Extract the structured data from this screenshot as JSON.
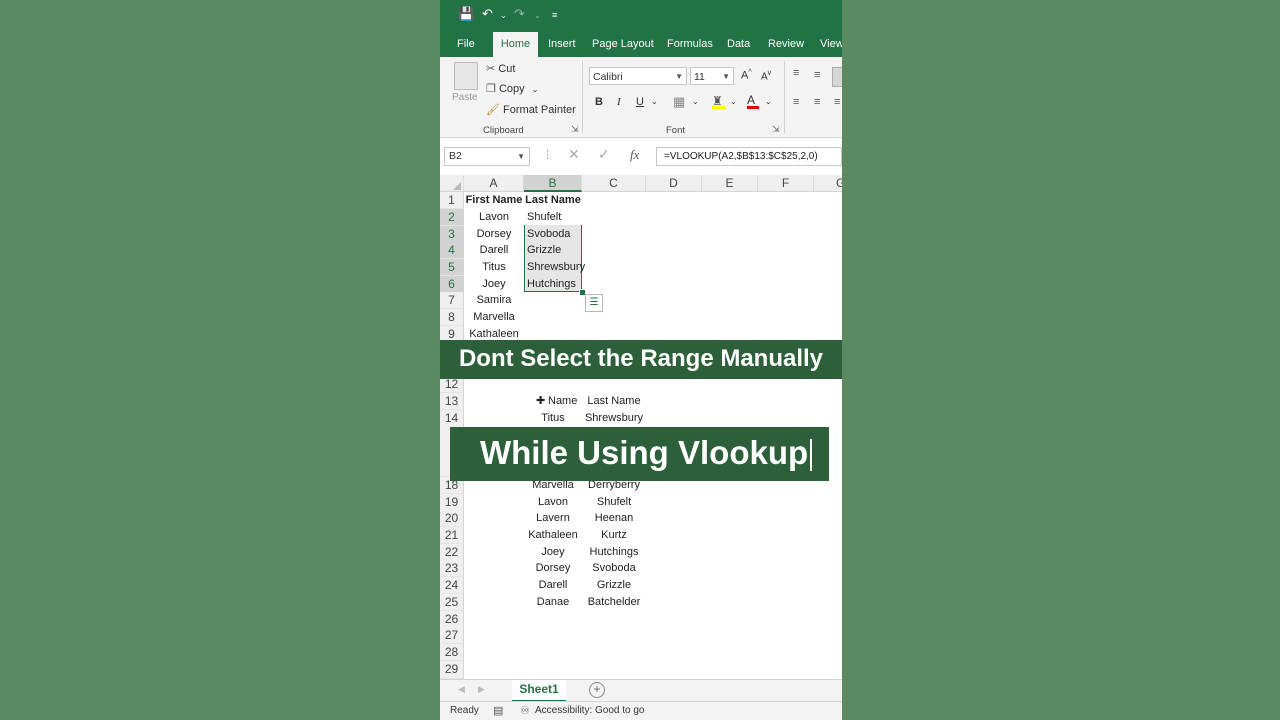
{
  "ribbon_tabs": [
    "File",
    "Home",
    "Insert",
    "Page Layout",
    "Formulas",
    "Data",
    "Review",
    "View"
  ],
  "clipboard": {
    "paste": "Paste",
    "cut": "Cut",
    "copy": "Copy",
    "format_painter": "Format Painter",
    "group": "Clipboard"
  },
  "font": {
    "name": "Calibri",
    "size": "11",
    "group": "Font",
    "bold": "B",
    "italic": "I",
    "underline": "U"
  },
  "formula_bar": {
    "name_box": "B2",
    "fx": "fx",
    "formula": "=VLOOKUP(A2,$B$13:$C$25,2,0)"
  },
  "columns": [
    "A",
    "B",
    "C",
    "D",
    "E",
    "F",
    "G"
  ],
  "rows": [
    "1",
    "2",
    "3",
    "4",
    "5",
    "6",
    "7",
    "8",
    "9",
    "12",
    "13",
    "14",
    "18",
    "19",
    "20",
    "21",
    "22",
    "23",
    "24",
    "25",
    "26",
    "27",
    "28",
    "29"
  ],
  "table1": {
    "header": {
      "a": "First Name",
      "b": "Last Name"
    },
    "rows": [
      {
        "a": "Lavon",
        "b": "Shufelt"
      },
      {
        "a": "Dorsey",
        "b": "Svoboda"
      },
      {
        "a": "Darell",
        "b": "Grizzle"
      },
      {
        "a": "Titus",
        "b": "Shrewsbury"
      },
      {
        "a": "Joey",
        "b": "Hutchings"
      },
      {
        "a": "Samira",
        "b": ""
      },
      {
        "a": "Marvella",
        "b": ""
      },
      {
        "a": "Kathaleen",
        "b": ""
      }
    ]
  },
  "table2": {
    "header": {
      "b": "Name",
      "c": "Last Name"
    },
    "rows": [
      {
        "r": "14",
        "b": "Titus",
        "c": "Shrewsbury"
      },
      {
        "r": "18",
        "b": "Marvella",
        "c": "Derryberry"
      },
      {
        "r": "19",
        "b": "Lavon",
        "c": "Shufelt"
      },
      {
        "r": "20",
        "b": "Lavern",
        "c": "Heenan"
      },
      {
        "r": "21",
        "b": "Kathaleen",
        "c": "Kurtz"
      },
      {
        "r": "22",
        "b": "Joey",
        "c": "Hutchings"
      },
      {
        "r": "23",
        "b": "Dorsey",
        "c": "Svoboda"
      },
      {
        "r": "24",
        "b": "Darell",
        "c": "Grizzle"
      },
      {
        "r": "25",
        "b": "Danae",
        "c": "Batchelder"
      }
    ]
  },
  "banners": {
    "top": "Dont Select the Range Manually",
    "bottom": "While Using Vlookup"
  },
  "sheet_tab": "Sheet1",
  "status": {
    "ready": "Ready",
    "accessibility": "Accessibility: Good to go"
  }
}
